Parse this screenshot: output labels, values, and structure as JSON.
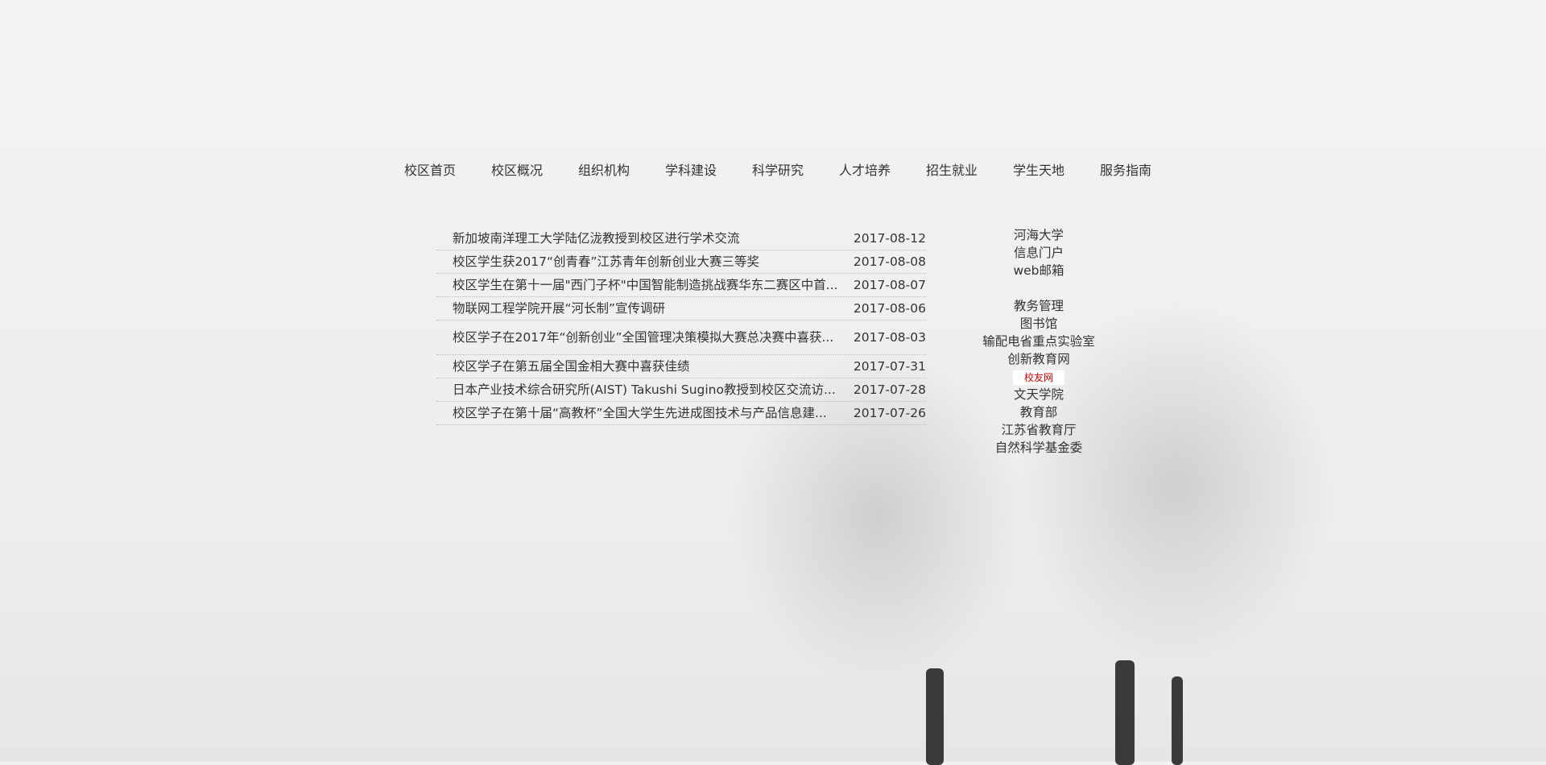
{
  "nav": [
    "校区首页",
    "校区概况",
    "组织机构",
    "学科建设",
    "科学研究",
    "人才培养",
    "招生就业",
    "学生天地",
    "服务指南"
  ],
  "news": [
    {
      "title": "新加坡南洋理工大学陆亿泷教授到校区进行学术交流",
      "date": "2017-08-12"
    },
    {
      "title": "校区学生获2017“创青春”江苏青年创新创业大赛三等奖",
      "date": "2017-08-08"
    },
    {
      "title": "校区学生在第十一届\"西门子杯\"中国智能制造挑战赛华东二赛区中首...",
      "date": "2017-08-07"
    },
    {
      "title": "物联网工程学院开展“河长制”宣传调研",
      "date": "2017-08-06"
    },
    {
      "title": "校区学子在2017年“创新创业”全国管理决策模拟大赛总决赛中喜获...",
      "date": "2017-08-03"
    },
    {
      "title": "校区学子在第五届全国金相大赛中喜获佳绩",
      "date": "2017-07-31"
    },
    {
      "title": "日本产业技术综合研究所(AIST) Takushi Sugino教授到校区交流访...",
      "date": "2017-07-28"
    },
    {
      "title": "校区学子在第十届“高教杯”全国大学生先进成图技术与产品信息建...",
      "date": "2017-07-26"
    }
  ],
  "links_top": [
    "河海大学",
    "信息门户",
    "web邮箱"
  ],
  "links_bottom": [
    "教务管理",
    "图书馆",
    "输配电省重点实验室",
    "创新教育网"
  ],
  "alumni": "校友网",
  "links_end": [
    "文天学院",
    "教育部",
    "江苏省教育厅",
    "自然科学基金委"
  ],
  "colors": {
    "alumni_text": "#cc0000",
    "background": "#f2f2f2"
  }
}
